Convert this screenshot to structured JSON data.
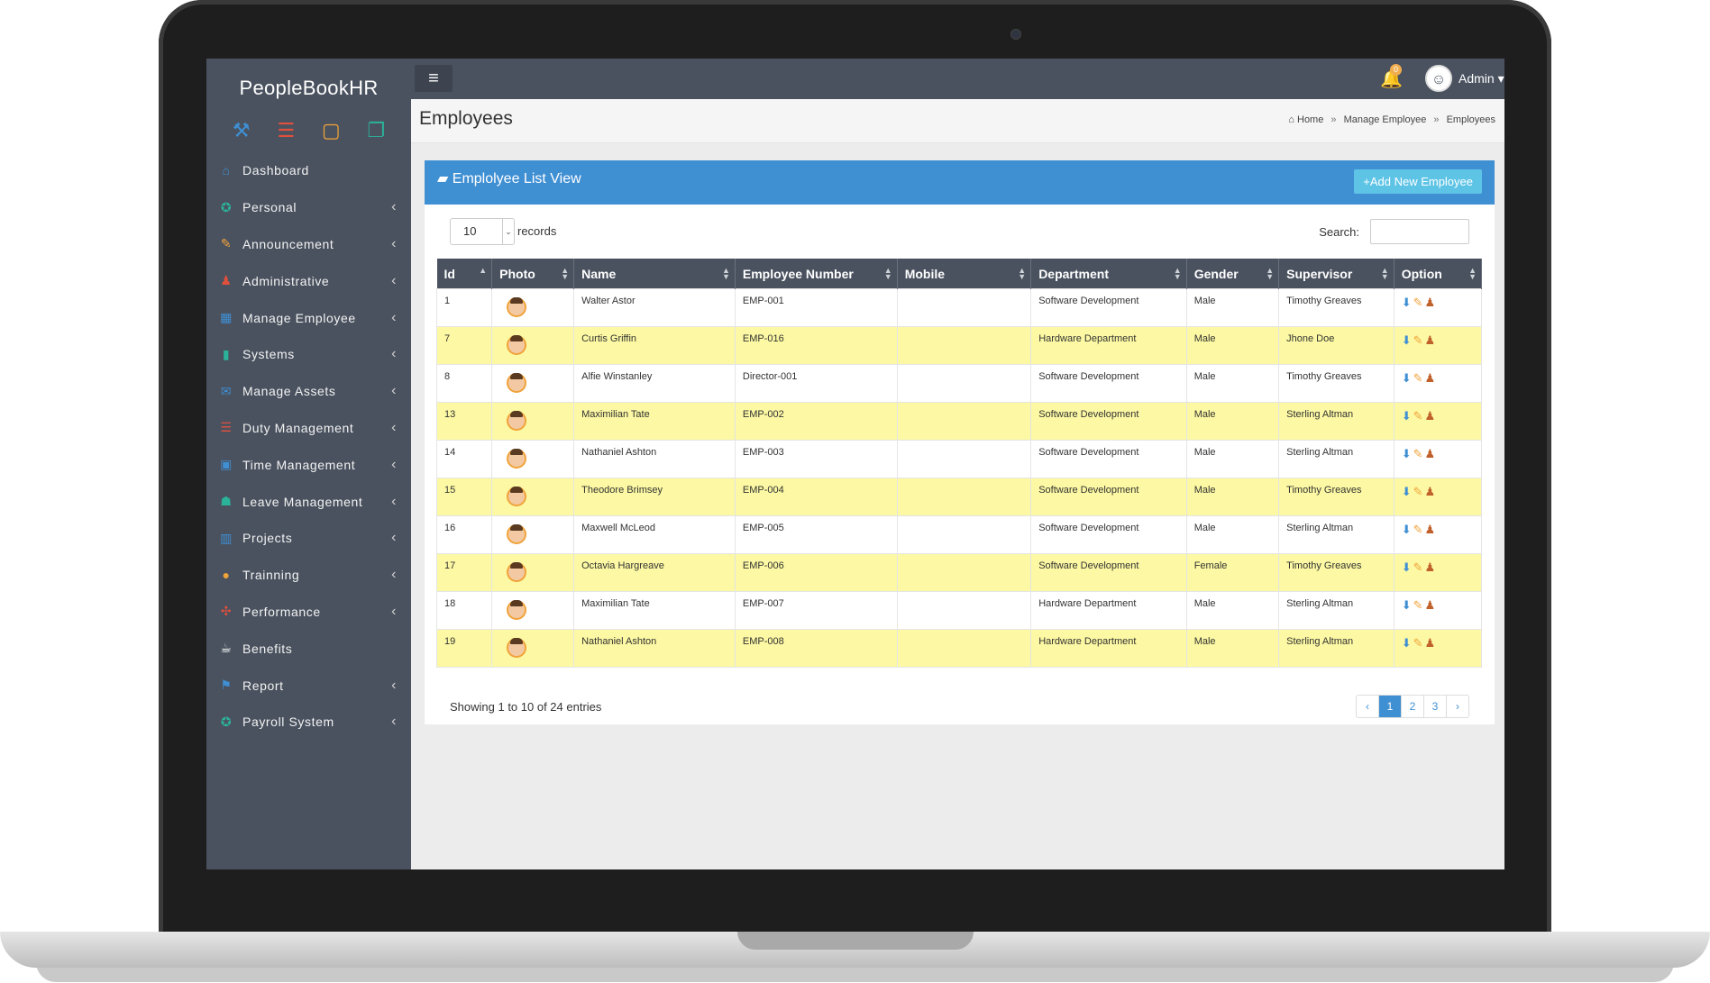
{
  "app": {
    "brand": "PeopleBookHR"
  },
  "quick_icons": [
    {
      "icon": "hammer-icon",
      "glyph": "⚒",
      "color": "#3f8fd3"
    },
    {
      "icon": "list-icon",
      "glyph": "☰",
      "color": "#e0503c"
    },
    {
      "icon": "square-icon",
      "glyph": "▢",
      "color": "#f0a33a"
    },
    {
      "icon": "window-icon",
      "glyph": "❐",
      "color": "#2bb39a"
    }
  ],
  "sidebar": {
    "items": [
      {
        "label": "Dashboard",
        "icon": "home-icon",
        "glyph": "⌂",
        "color": "#3f8fd3",
        "chevron": ""
      },
      {
        "label": "Personal",
        "icon": "ribbon-icon",
        "glyph": "✪",
        "color": "#2bb39a",
        "chevron": "‹"
      },
      {
        "label": "Announcement",
        "icon": "pencil-icon",
        "glyph": "✎",
        "color": "#f0a33a",
        "chevron": "‹"
      },
      {
        "label": "Administrative",
        "icon": "chess-icon",
        "glyph": "♟",
        "color": "#e0503c",
        "chevron": "‹"
      },
      {
        "label": "Manage Employee",
        "icon": "grid-icon",
        "glyph": "▦",
        "color": "#3f8fd3",
        "chevron": "‹"
      },
      {
        "label": "Systems",
        "icon": "bar-chart-icon",
        "glyph": "▮",
        "color": "#2bb39a",
        "chevron": "‹"
      },
      {
        "label": "Manage Assets",
        "icon": "envelope-icon",
        "glyph": "✉",
        "color": "#3f8fd3",
        "chevron": "‹"
      },
      {
        "label": "Duty Management",
        "icon": "list-icon",
        "glyph": "☰",
        "color": "#e0503c",
        "chevron": "‹"
      },
      {
        "label": "Time Management",
        "icon": "image-icon",
        "glyph": "▣",
        "color": "#3f8fd3",
        "chevron": "‹"
      },
      {
        "label": "Leave Management",
        "icon": "group-icon",
        "glyph": "☗",
        "color": "#2bb39a",
        "chevron": "‹"
      },
      {
        "label": "Projects",
        "icon": "books-icon",
        "glyph": "▥",
        "color": "#3f8fd3",
        "chevron": "‹"
      },
      {
        "label": "Trainning",
        "icon": "chat-icon",
        "glyph": "●",
        "color": "#f0a33a",
        "chevron": "‹"
      },
      {
        "label": "Performance",
        "icon": "move-icon",
        "glyph": "✣",
        "color": "#e0503c",
        "chevron": "‹"
      },
      {
        "label": "Benefits",
        "icon": "coffee-icon",
        "glyph": "☕",
        "color": "#ffffff",
        "chevron": ""
      },
      {
        "label": "Report",
        "icon": "flag-icon",
        "glyph": "⚑",
        "color": "#3f8fd3",
        "chevron": "‹"
      },
      {
        "label": "Payroll System",
        "icon": "award-icon",
        "glyph": "✪",
        "color": "#2bb39a",
        "chevron": "‹"
      }
    ]
  },
  "topbar": {
    "notification_count": "0",
    "user": "Admin ▾"
  },
  "page": {
    "title": "Employees",
    "breadcrumb": [
      "Home",
      "Manage Employee",
      "Employees"
    ]
  },
  "panel": {
    "title": "Emplolyee List View",
    "add_button": "Add New Employee",
    "page_length": "10",
    "records_label": "records",
    "search_label": "Search:",
    "showing": "Showing 1 to 10 of 24 entries",
    "pages": [
      "1",
      "2",
      "3"
    ],
    "current_page": "1"
  },
  "table": {
    "columns": [
      "Id",
      "Photo",
      "Name",
      "Employee Number",
      "Mobile",
      "Department",
      "Gender",
      "Supervisor",
      "Option"
    ],
    "rows": [
      {
        "id": "1",
        "name": "Walter Astor",
        "emp": "EMP-001",
        "mobile": "",
        "dept": "Software Development",
        "gender": "Male",
        "sup": "Timothy Greaves"
      },
      {
        "id": "7",
        "name": "Curtis Griffin",
        "emp": "EMP-016",
        "mobile": "",
        "dept": "Hardware Department",
        "gender": "Male",
        "sup": "Jhone Doe"
      },
      {
        "id": "8",
        "name": "Alfie Winstanley",
        "emp": "Director-001",
        "mobile": "",
        "dept": "Software Development",
        "gender": "Male",
        "sup": "Timothy Greaves"
      },
      {
        "id": "13",
        "name": "Maximilian Tate",
        "emp": "EMP-002",
        "mobile": "",
        "dept": "Software Development",
        "gender": "Male",
        "sup": "Sterling Altman"
      },
      {
        "id": "14",
        "name": "Nathaniel Ashton",
        "emp": "EMP-003",
        "mobile": "",
        "dept": "Software Development",
        "gender": "Male",
        "sup": "Sterling Altman"
      },
      {
        "id": "15",
        "name": "Theodore Brimsey",
        "emp": "EMP-004",
        "mobile": "",
        "dept": "Software Development",
        "gender": "Male",
        "sup": "Timothy Greaves"
      },
      {
        "id": "16",
        "name": "Maxwell McLeod",
        "emp": "EMP-005",
        "mobile": "",
        "dept": "Software Development",
        "gender": "Male",
        "sup": "Sterling Altman"
      },
      {
        "id": "17",
        "name": "Octavia Hargreave",
        "emp": "EMP-006",
        "mobile": "",
        "dept": "Software Development",
        "gender": "Female",
        "sup": "Timothy Greaves"
      },
      {
        "id": "18",
        "name": "Maximilian Tate",
        "emp": "EMP-007",
        "mobile": "",
        "dept": "Hardware Department",
        "gender": "Male",
        "sup": "Sterling Altman"
      },
      {
        "id": "19",
        "name": "Nathaniel Ashton",
        "emp": "EMP-008",
        "mobile": "",
        "dept": "Hardware Department",
        "gender": "Male",
        "sup": "Sterling Altman"
      }
    ]
  },
  "colors": {
    "sidebar": "#4a525f",
    "accent": "#3f8fd3",
    "row_highlight": "#fcf8a3"
  }
}
